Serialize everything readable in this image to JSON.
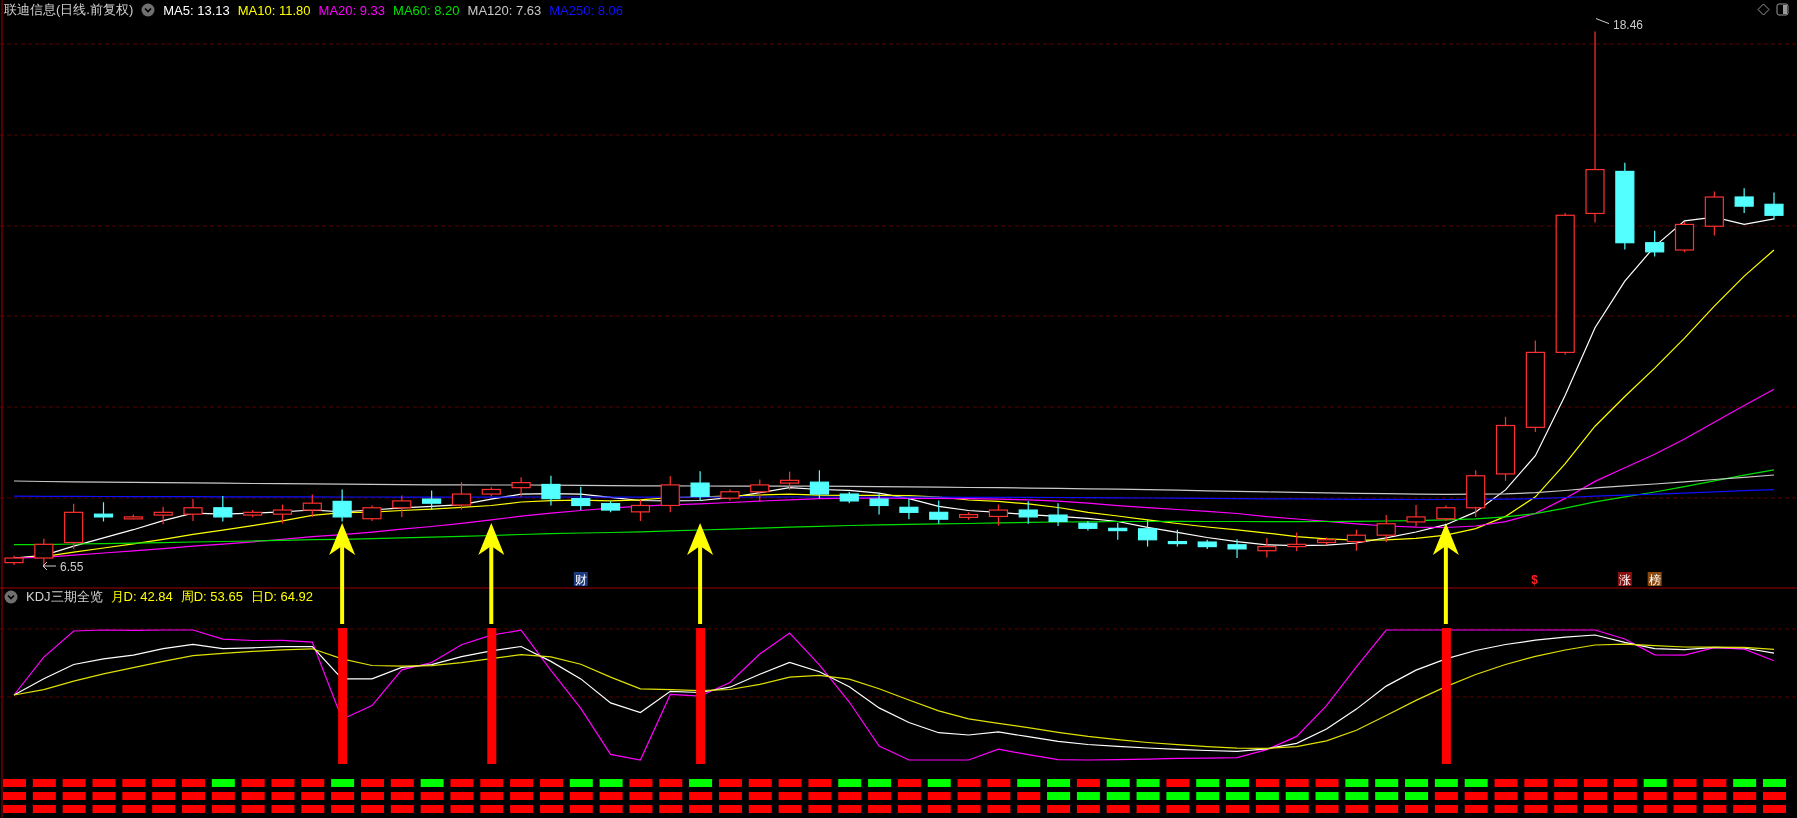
{
  "title": "联迪信息(日线.前复权)",
  "ma_legend": [
    {
      "label": "MA5: 13.13",
      "color": "#ffffff"
    },
    {
      "label": "MA10: 11.80",
      "color": "#ffff00"
    },
    {
      "label": "MA20: 9.33",
      "color": "#ff00ff"
    },
    {
      "label": "MA60: 8.20",
      "color": "#00e000"
    },
    {
      "label": "MA120: 7.63",
      "color": "#c8c8c8"
    },
    {
      "label": "MA250: 8.06",
      "color": "#1010ff"
    }
  ],
  "price_marks": {
    "high": "18.46",
    "low": "6.55"
  },
  "event_tags": [
    {
      "label": "财",
      "kind": "badge",
      "color": "#1c3a80"
    },
    {
      "label": "$",
      "kind": "glyph",
      "color": "#ff2020"
    },
    {
      "label": "涨",
      "kind": "badge",
      "color": "#8a1010"
    },
    {
      "label": "榜",
      "kind": "badge",
      "color": "#8a4a10"
    }
  ],
  "kdj": {
    "title": "KDJ三期全览",
    "values": [
      {
        "label": "月D: 42.84",
        "color": "#ffff00"
      },
      {
        "label": "周D: 53.65",
        "color": "#ffff00"
      },
      {
        "label": "日D: 64.92",
        "color": "#ffff00"
      }
    ]
  }
}
